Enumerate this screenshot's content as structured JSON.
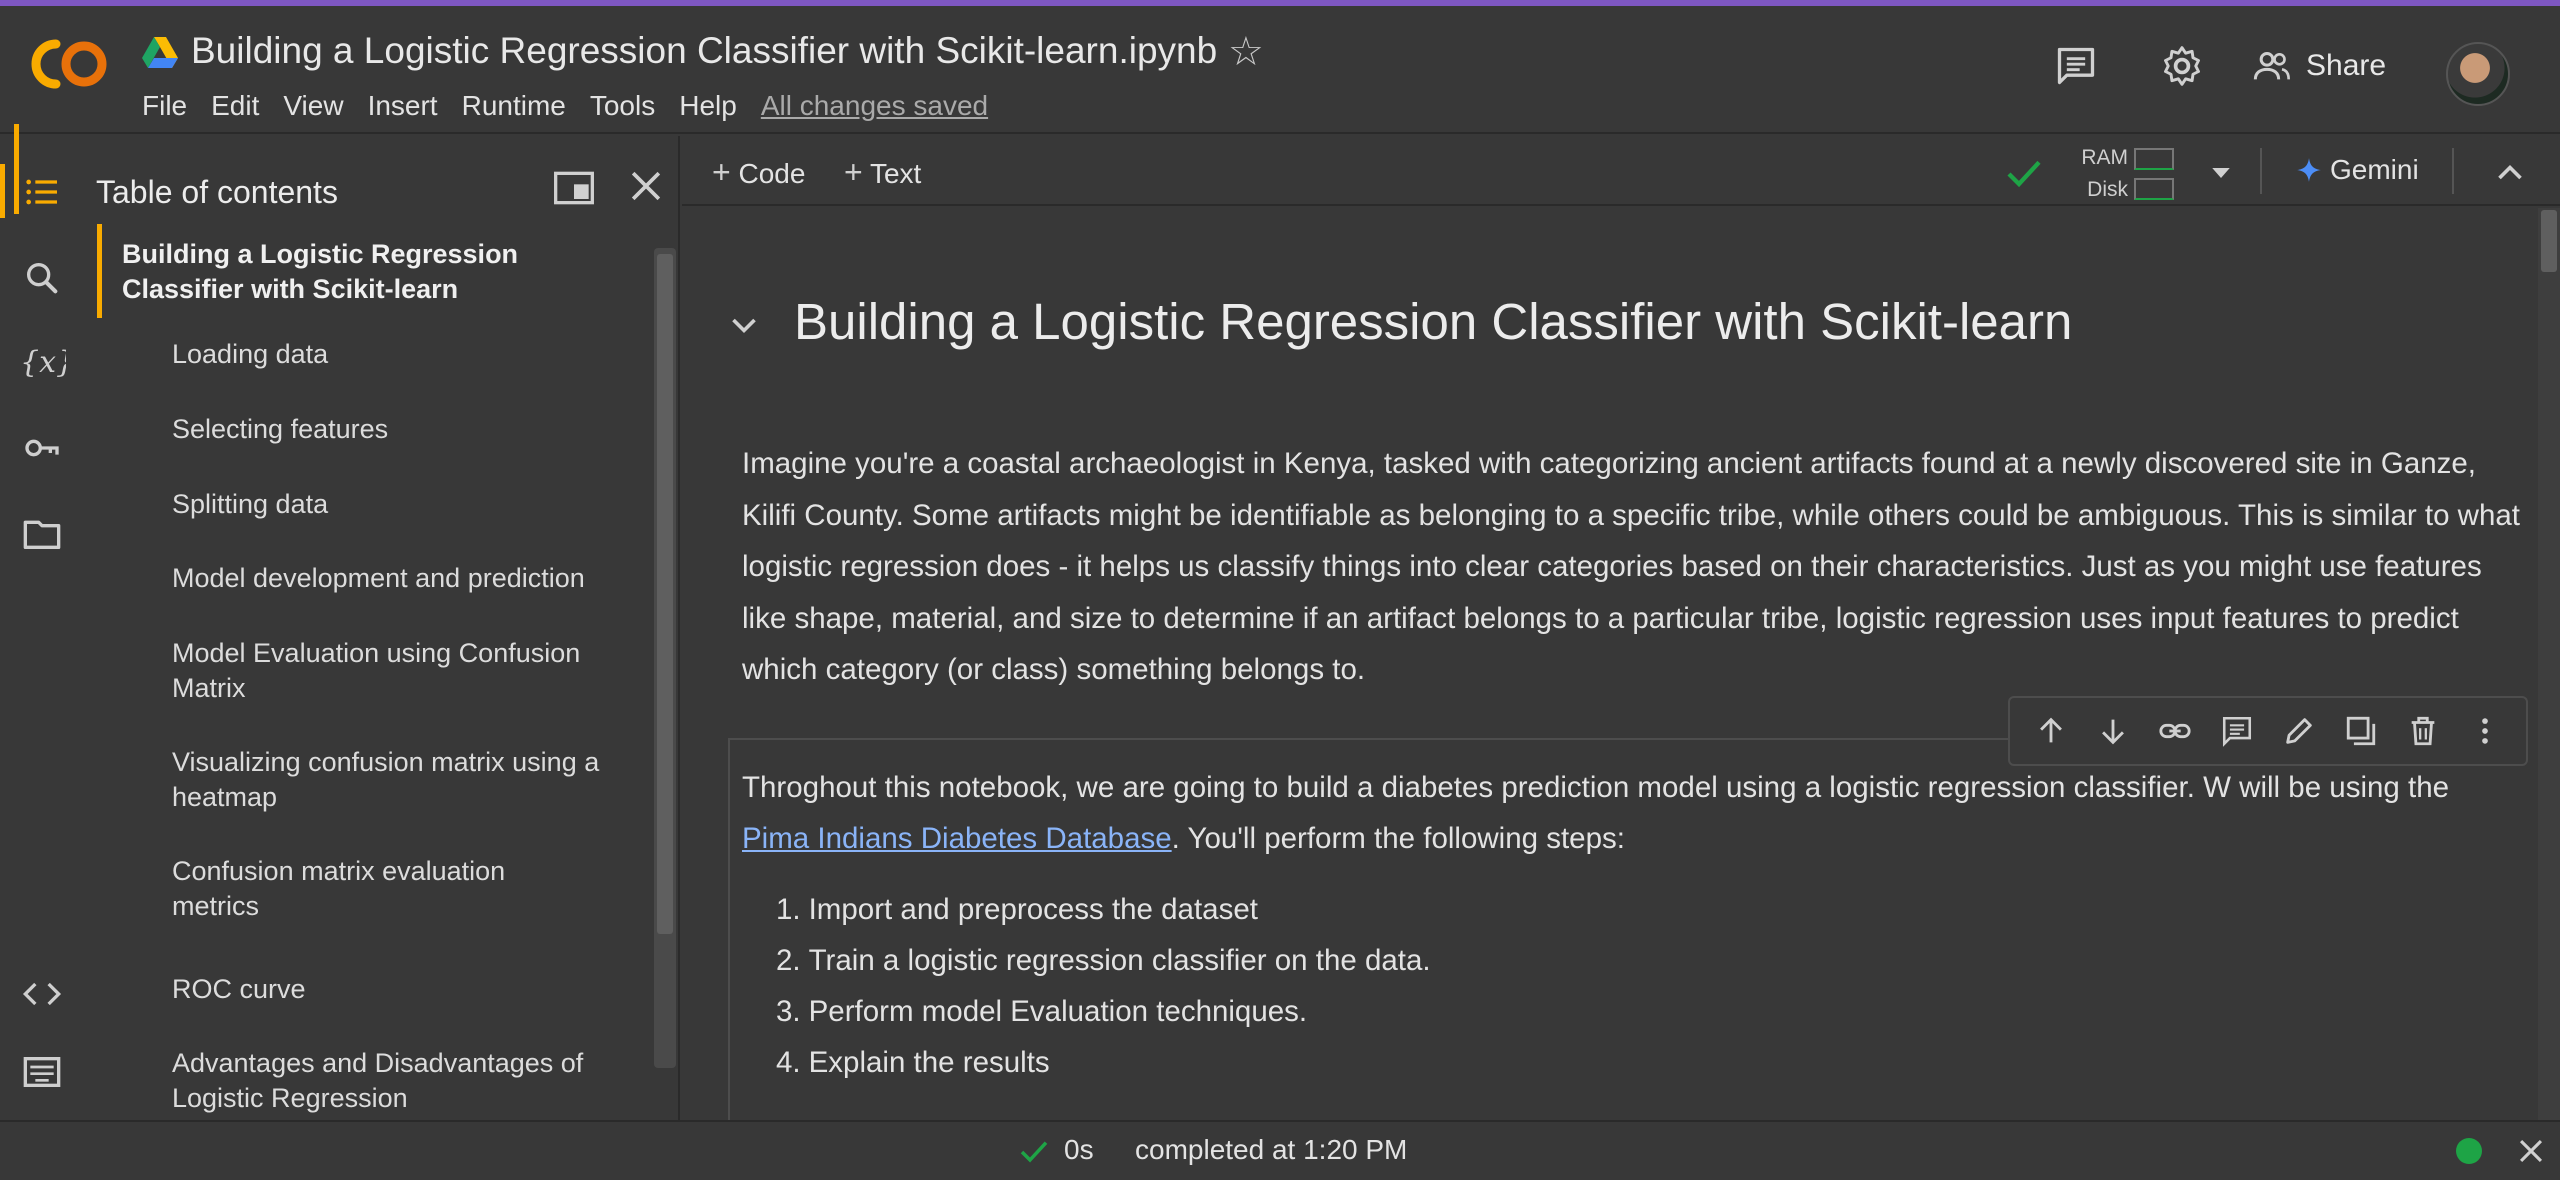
{
  "app": {
    "title": "Building a Logistic Regression Classifier with Scikit-learn.ipynb",
    "save_status": "All changes saved"
  },
  "menu": [
    "File",
    "Edit",
    "View",
    "Insert",
    "Runtime",
    "Tools",
    "Help"
  ],
  "header_right": {
    "share_label": "Share"
  },
  "sidebar_icons": [
    "table-of-contents-icon",
    "search-icon",
    "variables-icon",
    "secrets-key-icon",
    "files-folder-icon",
    "code-snippets-icon",
    "command-palette-icon"
  ],
  "toc": {
    "title": "Table of contents",
    "items": [
      {
        "label": "Building a Logistic Regression Classifier with Scikit-learn",
        "level": 1
      },
      {
        "label": "Loading data",
        "level": 2
      },
      {
        "label": "Selecting features",
        "level": 2
      },
      {
        "label": "Splitting data",
        "level": 2
      },
      {
        "label": "Model development and prediction",
        "level": 2
      },
      {
        "label": "Model Evaluation using Confusion Matrix",
        "level": 2
      },
      {
        "label": "Visualizing confusion matrix using a heatmap",
        "level": 2
      },
      {
        "label": "Confusion matrix evaluation metrics",
        "level": 2
      },
      {
        "label": "ROC curve",
        "level": 2
      },
      {
        "label": "Advantages and Disadvantages of Logistic Regression",
        "level": 2
      }
    ]
  },
  "toolbar": {
    "code_label": "Code",
    "text_label": "Text",
    "ram_label": "RAM",
    "disk_label": "Disk",
    "gemini_label": "Gemini"
  },
  "notebook": {
    "heading": "Building a Logistic Regression Classifier with Scikit-learn",
    "intro": "Imagine you're a coastal archaeologist in Kenya, tasked with categorizing ancient artifacts found at a newly discovered site in Ganze, Kilifi County. Some artifacts might be identifiable as belonging to a specific tribe, while others could be ambiguous. This is similar to what logistic regression does - it helps us classify things into clear categories based on their characteristics. Just as you might use features like shape, material, and size to determine if an artifact belongs to a particular tribe, logistic regression uses input features to predict which category (or class) something belongs to.",
    "cell": {
      "text_before_link": "Throghout this notebook, we are going to build a diabetes prediction model using a logistic regression classifier. W will be using the ",
      "link_text": "Pima Indians Diabetes Database",
      "text_after_link": ". You'll perform the following steps:",
      "steps": [
        "Import and preprocess the dataset",
        "Train a logistic regression classifier on the data.",
        "Perform model Evaluation techniques.",
        "Explain the results"
      ],
      "toolbar_icons": [
        "move-up-icon",
        "move-down-icon",
        "link-icon",
        "comment-icon",
        "edit-icon",
        "mirror-cell-icon",
        "delete-icon",
        "more-options-icon"
      ]
    }
  },
  "statusbar": {
    "duration": "0s",
    "completed": "completed at 1:20 PM"
  },
  "colors": {
    "accent": "#f9ab00",
    "link": "#8ab4f8",
    "ok_green": "#1ea446",
    "top_stripe": "#7e57c2",
    "background": "#383838"
  }
}
